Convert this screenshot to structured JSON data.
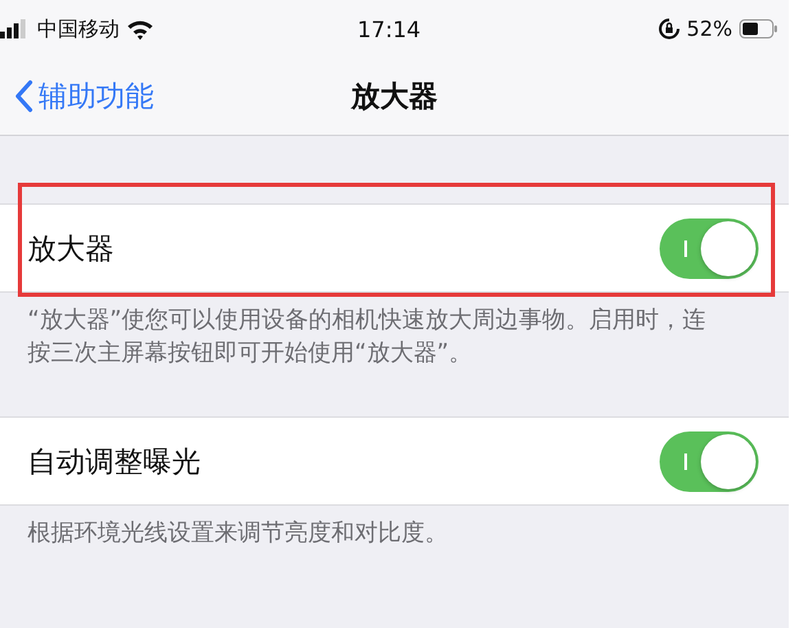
{
  "status_bar": {
    "carrier": "中国移动",
    "time": "17:14",
    "battery_percent": "52%"
  },
  "nav": {
    "back_label": "辅助功能",
    "title": "放大器"
  },
  "groups": [
    {
      "label": "放大器",
      "on": true,
      "highlighted": true,
      "footer": "“放大器”使您可以使用设备的相机快速放大周边事物。启用时，连按三次主屏幕按钮即可开始使用“放大器”。"
    },
    {
      "label": "自动调整曝光",
      "on": true,
      "highlighted": false,
      "footer": "根据环境光线设置来调节亮度和对比度。"
    }
  ]
}
